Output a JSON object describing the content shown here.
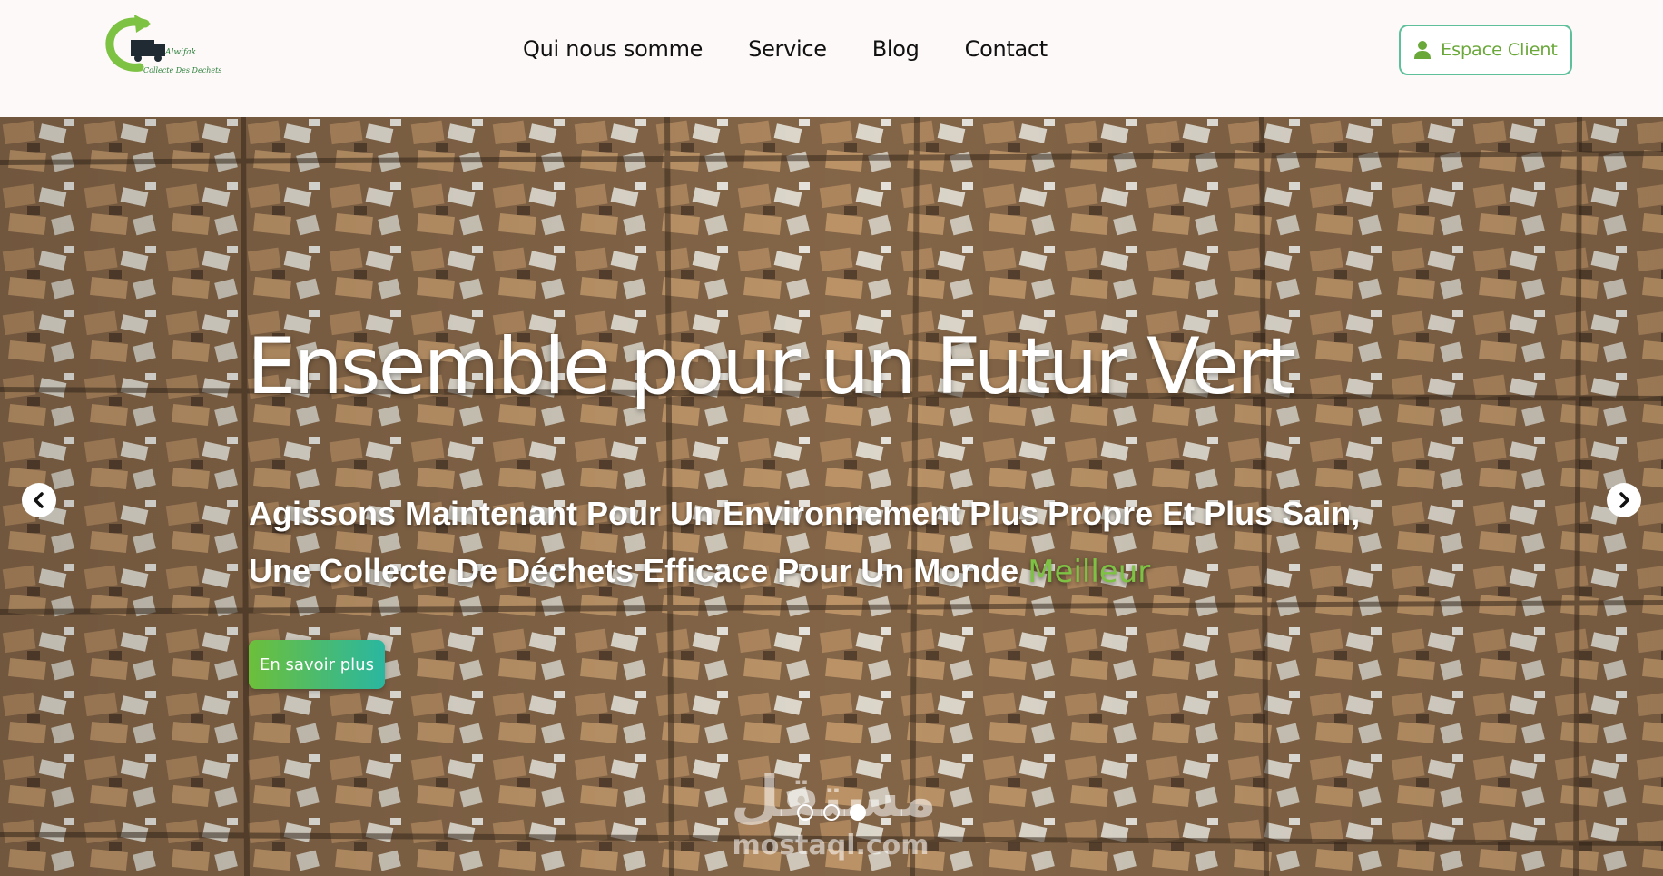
{
  "header": {
    "logo_text_line1": "Alwifak",
    "logo_text_line2": "Collecte Des Dechets",
    "nav": [
      {
        "label": "Qui nous somme"
      },
      {
        "label": "Service"
      },
      {
        "label": "Blog"
      },
      {
        "label": "Contact"
      }
    ],
    "client_button": {
      "label": "Espace Client",
      "icon": "user-icon"
    }
  },
  "hero": {
    "background": "compressed cardboard waste bales",
    "title": "Ensemble pour un Futur Vert",
    "subtitle_line1": "Agissons Maintenant Pour Un Environnement Plus Propre Et Plus Sain,",
    "subtitle_line2": "Une Collecte De Déchets Efficace Pour Un Monde",
    "subtitle_accent": "Meilleur",
    "cta_label": "En savoir plus",
    "prev_icon": "chevron-left-icon",
    "next_icon": "chevron-right-icon",
    "slides_total": 3,
    "active_slide": 3
  },
  "watermark": {
    "arabic": "مستقل",
    "latin": "mostaql.com"
  },
  "colors": {
    "accent_green": "#7dc243",
    "button_border": "#5ec09a",
    "cta_gradient_start": "#6dbf3a",
    "cta_gradient_end": "#2ab7a0"
  }
}
